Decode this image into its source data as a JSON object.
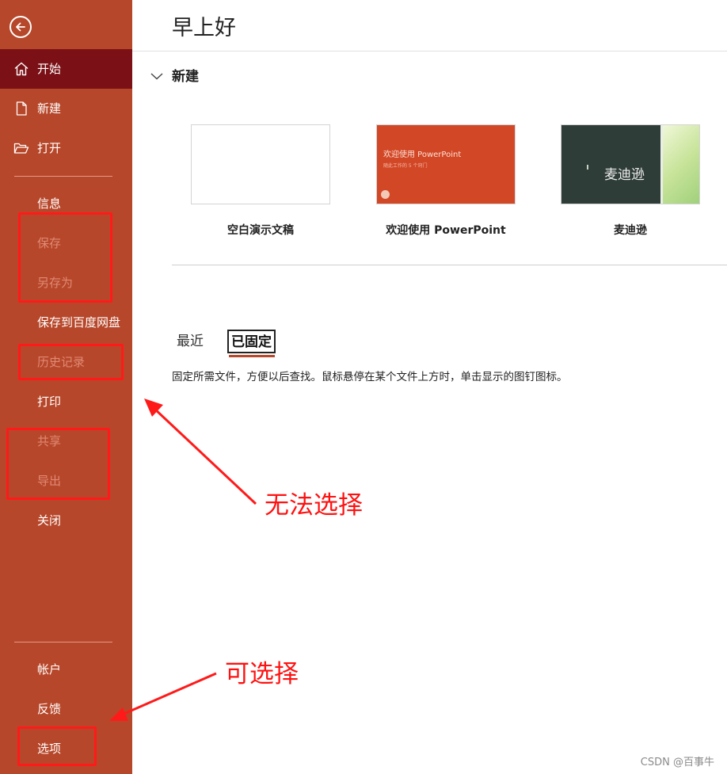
{
  "sidebar": {
    "items": [
      {
        "label": "开始",
        "icon": "home-icon",
        "active": true,
        "disabled": false
      },
      {
        "label": "新建",
        "icon": "new-document-icon",
        "active": false,
        "disabled": false
      },
      {
        "label": "打开",
        "icon": "folder-open-icon",
        "active": false,
        "disabled": false
      },
      {
        "label": "信息",
        "active": false,
        "disabled": false
      },
      {
        "label": "保存",
        "active": false,
        "disabled": true
      },
      {
        "label": "另存为",
        "active": false,
        "disabled": true
      },
      {
        "label": "保存到百度网盘",
        "active": false,
        "disabled": false
      },
      {
        "label": "历史记录",
        "active": false,
        "disabled": true
      },
      {
        "label": "打印",
        "active": false,
        "disabled": false
      },
      {
        "label": "共享",
        "active": false,
        "disabled": true
      },
      {
        "label": "导出",
        "active": false,
        "disabled": true
      },
      {
        "label": "关闭",
        "active": false,
        "disabled": false
      },
      {
        "label": "帐户",
        "active": false,
        "disabled": false
      },
      {
        "label": "反馈",
        "active": false,
        "disabled": false
      },
      {
        "label": "选项",
        "active": false,
        "disabled": false
      }
    ]
  },
  "main": {
    "greeting": "早上好",
    "new_section": {
      "heading": "新建",
      "templates": [
        {
          "label": "空白演示文稿"
        },
        {
          "label": "欢迎使用 PowerPoint",
          "thumb_title": "欢迎使用 PowerPoint",
          "thumb_subtitle": "随此工作的 5 个窍门"
        },
        {
          "label": "麦迪逊",
          "thumb_title": "麦迪逊"
        }
      ]
    },
    "tabs": [
      {
        "label": "最近",
        "selected": false
      },
      {
        "label": "已固定",
        "selected": true
      }
    ],
    "pinned_hint": "固定所需文件，方便以后查找。鼠标悬停在某个文件上方时，单击显示的图钉图标。"
  },
  "annotations": {
    "cannot_select": "无法选择",
    "can_select": "可选择"
  },
  "watermark": "CSDN @百事牛",
  "colors": {
    "sidebar_bg": "#b7472a",
    "sidebar_active": "#7b1116",
    "disabled_text": "#df8a75",
    "annotation_red": "#ff1a1a"
  }
}
